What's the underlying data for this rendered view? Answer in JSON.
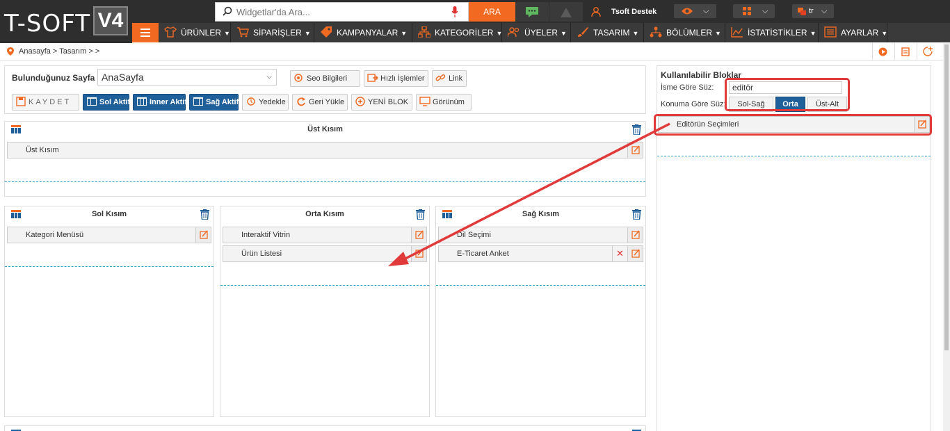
{
  "brand": {
    "logo_text": "T-SOFT",
    "version": "V4"
  },
  "header": {
    "search_placeholder": "Widgetlar'da Ara...",
    "search_button": "ARA",
    "user_name": "Tsoft Destek",
    "language": "tr"
  },
  "nav": {
    "items": [
      {
        "label": "ÜRÜNLER",
        "icon": "shirt-icon"
      },
      {
        "label": "SİPARİŞLER",
        "icon": "cart-icon"
      },
      {
        "label": "KAMPANYALAR",
        "icon": "tag-icon"
      },
      {
        "label": "KATEGORİLER",
        "icon": "sitemap-icon"
      },
      {
        "label": "ÜYELER",
        "icon": "users-icon"
      },
      {
        "label": "TASARIM",
        "icon": "brush-icon"
      },
      {
        "label": "BÖLÜMLER",
        "icon": "sections-icon"
      },
      {
        "label": "İSTATİSTİKLER",
        "icon": "chart-icon"
      },
      {
        "label": "AYARLAR",
        "icon": "settings-icon"
      }
    ]
  },
  "breadcrumb": "Anasayfa > Tasarım >  >",
  "page_settings": {
    "label": "Bulunduğunuz Sayfa",
    "selected_page": "AnaSayfa",
    "seo_button": "Seo Bilgileri",
    "quick_button": "Hızlı İşlemler",
    "link_button": "Link",
    "save_button": "KAYDET",
    "left_active": "Sol Aktif",
    "inner_active": "Inner Aktif",
    "right_active": "Sağ Aktif",
    "backup_button": "Yedekle",
    "restore_button": "Geri Yükle",
    "new_block_button": "YENİ BLOK",
    "view_button": "Görünüm"
  },
  "zones": {
    "top": {
      "title": "Üst Kısım",
      "blocks": [
        "Üst Kısım"
      ]
    },
    "left": {
      "title": "Sol Kısım",
      "blocks": [
        "Kategori Menüsü"
      ]
    },
    "center": {
      "title": "Orta Kısım",
      "blocks": [
        "Interaktif Vitrin",
        "Ürün Listesi"
      ]
    },
    "right": {
      "title": "Sağ Kısım",
      "blocks": [
        "Dil Seçimi",
        "E-Ticaret Anket"
      ]
    }
  },
  "available_blocks": {
    "title": "Kullanılabilir Bloklar",
    "filter_name_label": "İsme Göre Süz:",
    "filter_name_value": "editör",
    "filter_position_label": "Konuma Göre Süz:",
    "positions": [
      "Sol-Sağ",
      "Orta",
      "Üst-Alt"
    ],
    "active_position": "Orta",
    "results": [
      "Editörün Seçimleri"
    ]
  },
  "colors": {
    "accent": "#f26a21",
    "primary": "#1f5f9a",
    "annotation": "#e03a3a",
    "dark": "#2e2e2e"
  }
}
